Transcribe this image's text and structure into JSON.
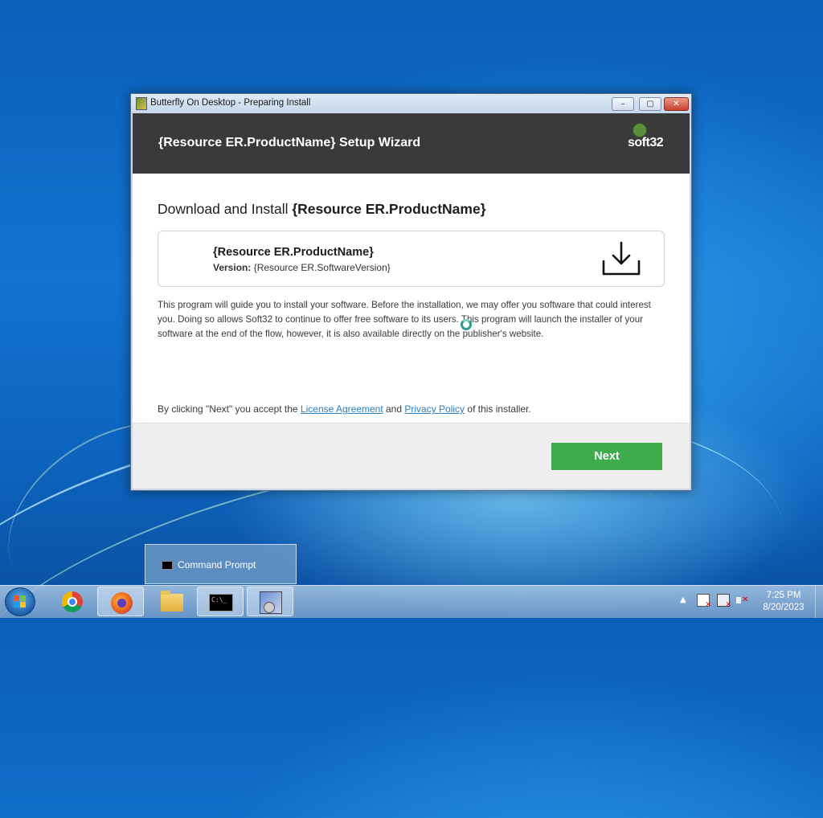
{
  "window": {
    "title": "Butterfly On Desktop - Preparing Install",
    "controls": {
      "minimize": "–",
      "maximize": "▢",
      "close": "✕"
    }
  },
  "wizard": {
    "header_title": "{Resource ER.ProductName} Setup Wizard",
    "brand_logo_text": "soft32",
    "section_prefix": "Download and Install ",
    "section_product": "{Resource ER.ProductName}",
    "product_name": "{Resource ER.ProductName}",
    "version_label": "Version:",
    "version_value": " {Resource ER.SoftwareVersion}",
    "description": "This program will guide you to install your software. Before the installation, we may offer you software that could interest you. Doing so allows Soft32 to continue to offer free software to its users. This program will launch the installer of your software at the end of the flow, however, it is also available directly on the publisher's website.",
    "consent_prefix": "By clicking \"Next\" you accept the ",
    "license_link": "License Agreement",
    "consent_and": " and ",
    "privacy_link": "Privacy Policy",
    "consent_suffix": " of this installer.",
    "next_label": "Next"
  },
  "taskbar": {
    "preview_label": "Command Prompt",
    "pinned": [
      "start-icon",
      "chrome-icon",
      "firefox-icon",
      "explorer-folder-icon",
      "command-prompt-icon",
      "installer-icon"
    ],
    "clock_time": "7:25 PM",
    "clock_date": "8/20/2023"
  },
  "colors": {
    "header_band": "#3a3a3a",
    "next_button": "#3eab4c",
    "link": "#2a7fc0"
  }
}
